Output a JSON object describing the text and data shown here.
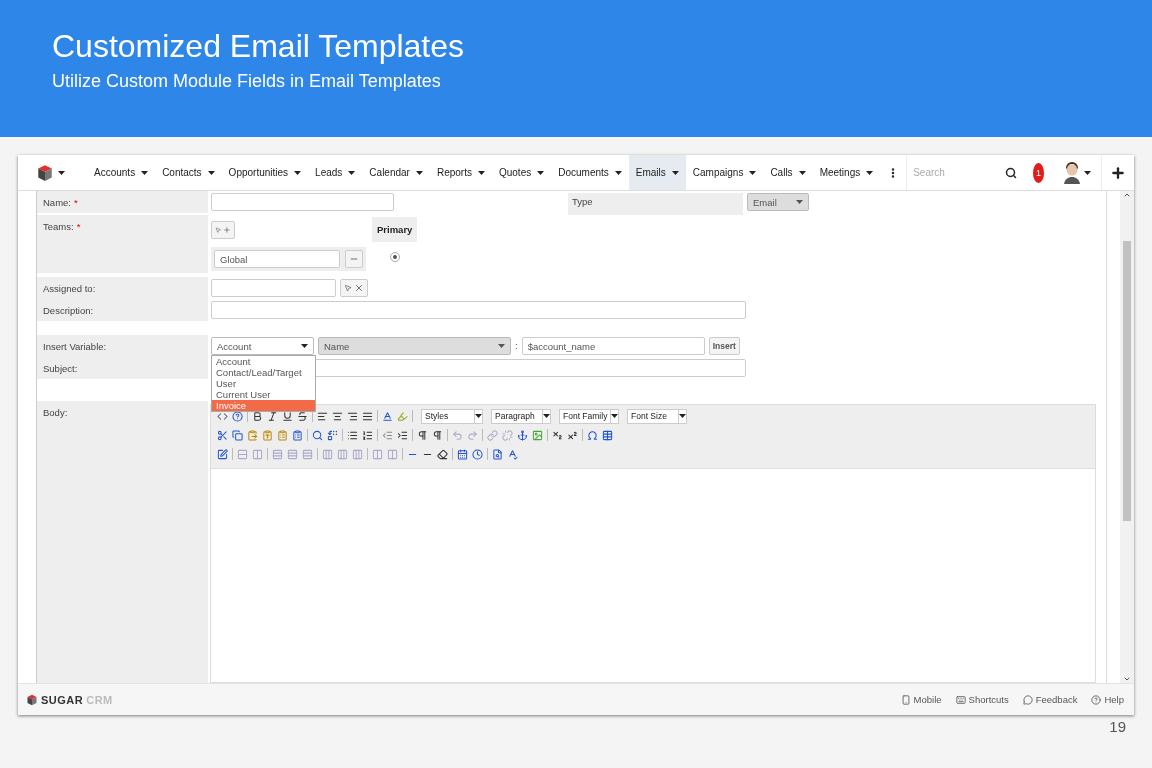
{
  "slide": {
    "title": "Customized Email Templates",
    "subtitle": "Utilize Custom Module Fields in Email Templates",
    "page_number": "19"
  },
  "nav": {
    "items": [
      {
        "label": "Accounts",
        "selected": false
      },
      {
        "label": "Contacts",
        "selected": false
      },
      {
        "label": "Opportunities",
        "selected": false
      },
      {
        "label": "Leads",
        "selected": false
      },
      {
        "label": "Calendar",
        "selected": false
      },
      {
        "label": "Reports",
        "selected": false
      },
      {
        "label": "Quotes",
        "selected": false
      },
      {
        "label": "Documents",
        "selected": false
      },
      {
        "label": "Emails",
        "selected": true
      },
      {
        "label": "Campaigns",
        "selected": false
      },
      {
        "label": "Calls",
        "selected": false
      },
      {
        "label": "Meetings",
        "selected": false
      }
    ],
    "search": {
      "placeholder": "Search"
    },
    "notification_count": "1"
  },
  "form": {
    "name": {
      "label": "Name:",
      "mark": "*"
    },
    "type": {
      "label": "Type",
      "value": "Email"
    },
    "teams": {
      "label": "Teams:",
      "mark": "*",
      "primary_header": "Primary",
      "team": "Global",
      "primary": true
    },
    "assigned_to": {
      "label": "Assigned to:"
    },
    "description": {
      "label": "Description:"
    },
    "insert_variable": {
      "label": "Insert Variable:",
      "module": "Account",
      "field": "Name",
      "separator": ":",
      "value": "$account_name",
      "button": "Insert",
      "options": [
        {
          "label": "Account",
          "selected": false
        },
        {
          "label": "Contact/Lead/Target",
          "selected": false
        },
        {
          "label": "User",
          "selected": false
        },
        {
          "label": "Current User",
          "selected": false
        },
        {
          "label": "Invoice",
          "selected": true
        }
      ]
    },
    "subject": {
      "label": "Subject:"
    },
    "body": {
      "label": "Body:",
      "selects": [
        "Styles",
        "Paragraph",
        "Font Family",
        "Font Size"
      ]
    }
  },
  "footer": {
    "logo": [
      "SUGAR",
      "CRM"
    ],
    "links": [
      "Mobile",
      "Shortcuts",
      "Feedback",
      "Help"
    ]
  }
}
